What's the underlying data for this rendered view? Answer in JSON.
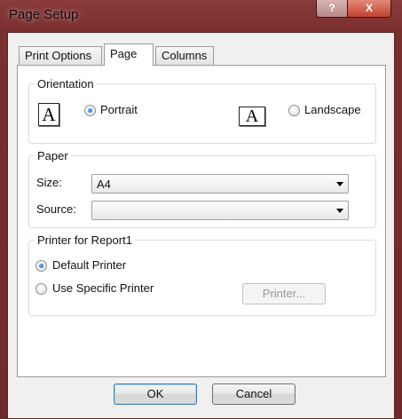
{
  "window": {
    "title": "Page Setup",
    "help_label": "?",
    "close_label": "X"
  },
  "tabs": [
    {
      "label": "Print Options"
    },
    {
      "label": "Page"
    },
    {
      "label": "Columns"
    }
  ],
  "orientation": {
    "legend": "Orientation",
    "portrait_label": "Portrait",
    "landscape_label": "Landscape",
    "icon_glyph": "A",
    "selected": "Portrait"
  },
  "paper": {
    "legend": "Paper",
    "size_label": "Size:",
    "size_value": "A4",
    "source_label": "Source:",
    "source_value": ""
  },
  "printer": {
    "legend": "Printer for Report1",
    "default_label": "Default Printer",
    "specific_label": "Use Specific Printer",
    "printer_button": "Printer...",
    "selected": "Default Printer"
  },
  "buttons": {
    "ok": "OK",
    "cancel": "Cancel"
  },
  "colors": {
    "frame": "#7a2f2f",
    "dialog_bg": "#f0f0f0",
    "close_button": "#c2412f"
  }
}
